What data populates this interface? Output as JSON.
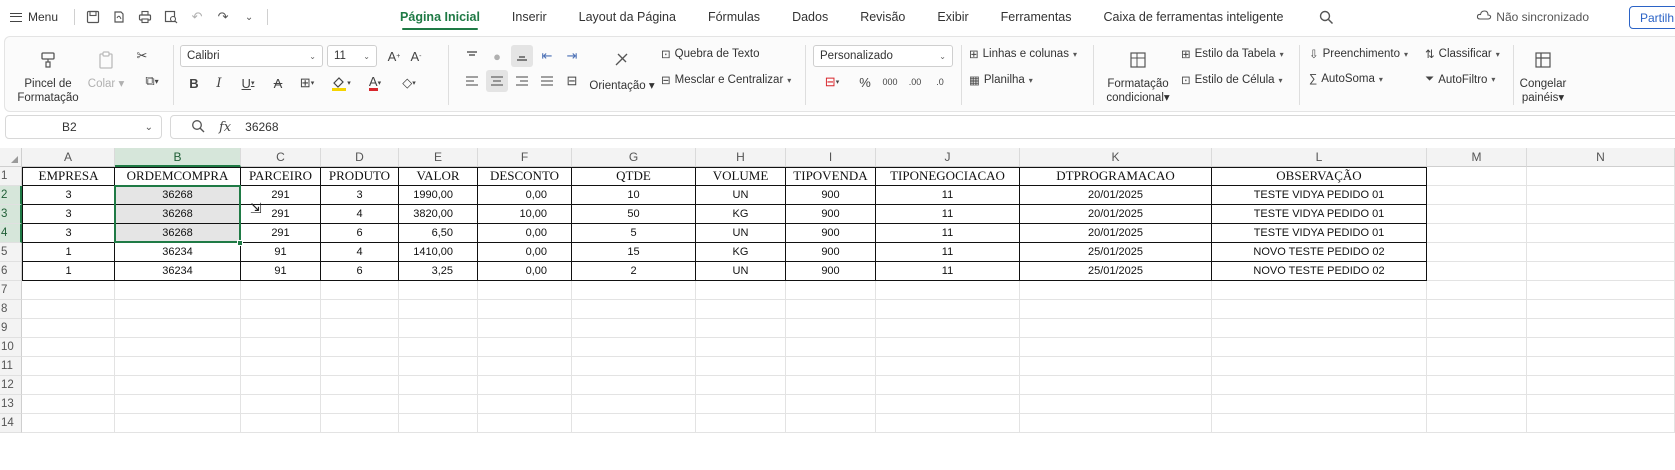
{
  "menubar": {
    "menu_label": "Menu",
    "tabs": [
      "Página Inicial",
      "Inserir",
      "Layout da Página",
      "Fórmulas",
      "Dados",
      "Revisão",
      "Exibir",
      "Ferramentas",
      "Caixa de ferramentas inteligente"
    ],
    "active_tab": "Página Inicial",
    "sync_status": "Não sincronizado",
    "share_label": "Partilh"
  },
  "ribbon": {
    "format_painter": "Pincel de\nFormatação",
    "paste": "Colar",
    "font_name": "Calibri",
    "font_size": "11",
    "wrap_text": "Quebra de Texto",
    "merge_center": "Mesclar e Centralizar",
    "orientation": "Orientação",
    "number_format": "Personalizado",
    "rows_cols": "Linhas e colunas",
    "sheet": "Planilha",
    "cond_format": "Formatação\ncondicional",
    "table_style": "Estilo da Tabela",
    "cell_style": "Estilo de Célula",
    "fill": "Preenchimento",
    "autosum": "AutoSoma",
    "sort": "Classificar",
    "autofilter": "AutoFiltro",
    "freeze": "Congelar\npainéis"
  },
  "formula_bar": {
    "cell_ref": "B2",
    "fx": "fx",
    "value": "36268"
  },
  "sheet": {
    "columns": [
      "A",
      "B",
      "C",
      "D",
      "E",
      "F",
      "G",
      "H",
      "I",
      "J",
      "K",
      "L",
      "M",
      "N"
    ],
    "row_numbers": [
      "1",
      "2",
      "3",
      "4",
      "5",
      "6",
      "7",
      "8",
      "9",
      "10",
      "11",
      "12",
      "13",
      "14"
    ],
    "headers": [
      "EMPRESA",
      "ORDEMCOMPRA",
      "PARCEIRO",
      "PRODUTO",
      "VALOR",
      "DESCONTO",
      "QTDE",
      "VOLUME",
      "TIPOVENDA",
      "TIPONEGOCIACAO",
      "DTPROGRAMACAO",
      "OBSERVAÇÃO"
    ],
    "rows": [
      [
        "3",
        "36268",
        "291",
        "3",
        "1990,00",
        "0,00",
        "10",
        "UN",
        "900",
        "11",
        "20/01/2025",
        "TESTE VIDYA PEDIDO 01"
      ],
      [
        "3",
        "36268",
        "291",
        "4",
        "3820,00",
        "10,00",
        "50",
        "KG",
        "900",
        "11",
        "20/01/2025",
        "TESTE VIDYA PEDIDO 01"
      ],
      [
        "3",
        "36268",
        "291",
        "6",
        "6,50",
        "0,00",
        "5",
        "UN",
        "900",
        "11",
        "20/01/2025",
        "TESTE VIDYA PEDIDO 01"
      ],
      [
        "1",
        "36234",
        "91",
        "4",
        "1410,00",
        "0,00",
        "15",
        "KG",
        "900",
        "11",
        "25/01/2025",
        "NOVO TESTE PEDIDO 02"
      ],
      [
        "1",
        "36234",
        "91",
        "6",
        "3,25",
        "0,00",
        "2",
        "UN",
        "900",
        "11",
        "25/01/2025",
        "NOVO TESTE PEDIDO 02"
      ]
    ],
    "selected_column": "B",
    "selected_rows": [
      "2",
      "3",
      "4"
    ]
  },
  "colors": {
    "accent": "#1f7a45",
    "selection_fill": "#e5e5e5",
    "comment_marker": "#d83b2b",
    "share_blue": "#2b63c6"
  }
}
